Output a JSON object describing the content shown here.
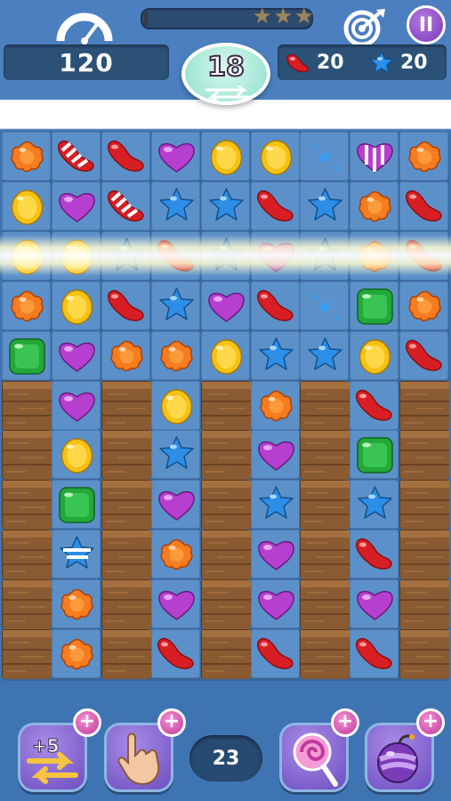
{
  "hud": {
    "score": "120",
    "moves_left": "18",
    "stars_total": 3,
    "pause_label": "II",
    "progress_fraction": 0.0,
    "goals": [
      {
        "icon": "red-jellybean-icon",
        "count": "20"
      },
      {
        "icon": "blue-star-candy-icon",
        "count": "20"
      }
    ]
  },
  "board": {
    "columns": 9,
    "rows": 11,
    "grid": [
      [
        "orange-flower",
        "red-striped-jellybean",
        "red-jellybean",
        "purple-heart",
        "yellow-drop",
        "yellow-drop",
        "splash",
        "purple-striped-heart",
        "orange-flower"
      ],
      [
        "yellow-drop",
        "purple-heart",
        "red-striped-jellybean",
        "blue-star",
        "blue-star",
        "red-jellybean",
        "blue-star",
        "orange-flower",
        "red-jellybean"
      ],
      [
        "yellow-drop",
        "yellow-drop",
        "blue-star",
        "red-jellybean",
        "blue-star",
        "purple-heart",
        "blue-star",
        "orange-flower",
        "red-jellybean"
      ],
      [
        "orange-flower",
        "yellow-drop",
        "red-jellybean",
        "blue-star",
        "purple-heart",
        "red-jellybean",
        "splash",
        "green-square",
        "orange-flower"
      ],
      [
        "green-square",
        "purple-heart",
        "orange-flower",
        "orange-flower",
        "yellow-drop",
        "blue-star",
        "blue-star",
        "yellow-drop",
        "red-jellybean"
      ],
      [
        "crate",
        "purple-heart",
        "crate",
        "yellow-drop",
        "crate",
        "orange-flower",
        "crate",
        "red-jellybean",
        "crate"
      ],
      [
        "crate",
        "yellow-drop",
        "crate",
        "blue-star",
        "crate",
        "purple-heart",
        "crate",
        "green-square",
        "crate"
      ],
      [
        "crate",
        "green-square",
        "crate",
        "purple-heart",
        "crate",
        "blue-star",
        "crate",
        "blue-star",
        "crate"
      ],
      [
        "crate",
        "blue-striped-star",
        "crate",
        "orange-flower",
        "crate",
        "purple-heart",
        "crate",
        "red-jellybean",
        "crate"
      ],
      [
        "crate",
        "orange-flower",
        "crate",
        "purple-heart",
        "crate",
        "purple-heart",
        "crate",
        "purple-heart",
        "crate"
      ],
      [
        "crate",
        "orange-flower",
        "crate",
        "red-jellybean",
        "crate",
        "red-jellybean",
        "crate",
        "red-jellybean",
        "crate"
      ]
    ],
    "effect": "horizontal-line-blast-row-3"
  },
  "boosters": {
    "extra_moves_label": "+5",
    "items": [
      {
        "name": "extra-moves-booster",
        "icon": "swap-arrows-icon"
      },
      {
        "name": "hand-booster",
        "icon": "hand-pointer-icon"
      },
      {
        "name": "lollipop-booster",
        "icon": "lollipop-icon"
      },
      {
        "name": "bomb-booster",
        "icon": "bomb-icon"
      }
    ],
    "add_label": "+",
    "center_counter": "23"
  },
  "colors": {
    "hud_blue": "#4b7fc0",
    "panel_dark": "#2c5177",
    "cell_blue": "#5c90c9",
    "pause_purple": "#7a37b8",
    "plus_pink": "#c0399a",
    "crate_brown": "#8a5a32"
  }
}
